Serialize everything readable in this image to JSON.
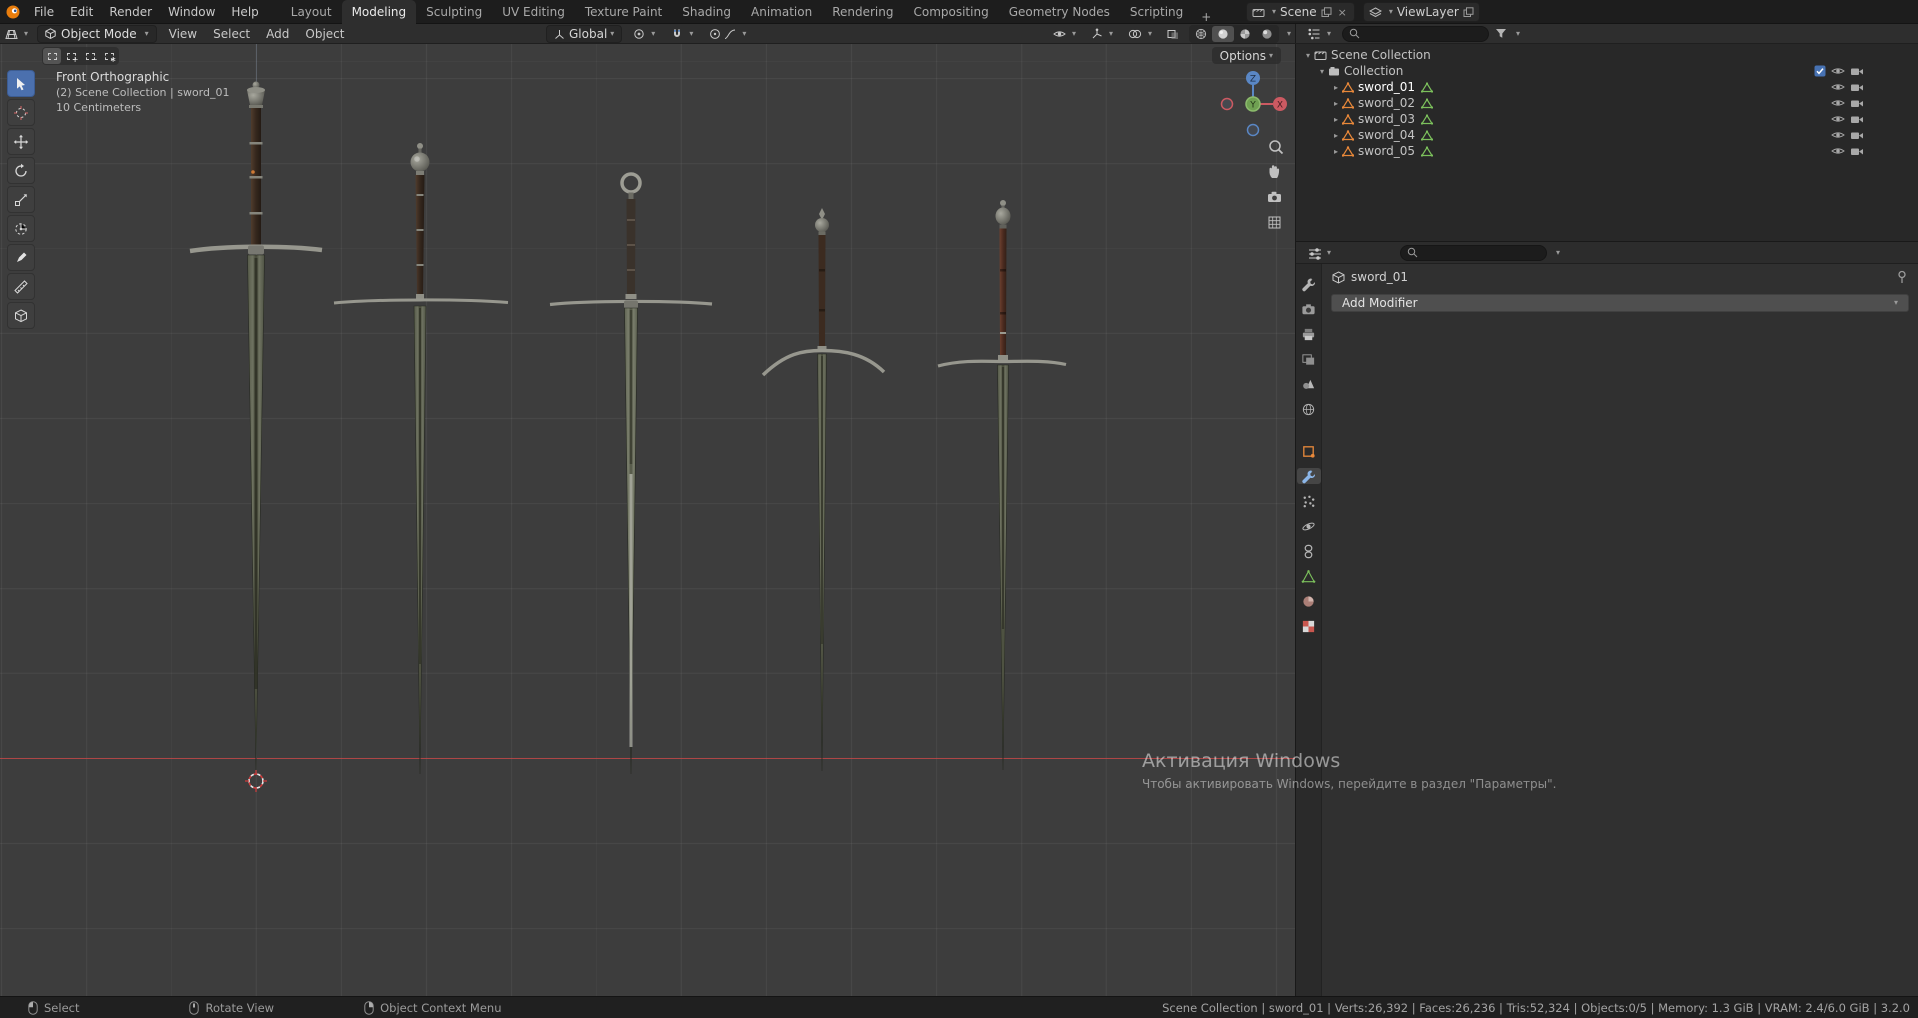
{
  "topbar": {
    "menus": [
      "File",
      "Edit",
      "Render",
      "Window",
      "Help"
    ],
    "workspaces": [
      "Layout",
      "Modeling",
      "Sculpting",
      "UV Editing",
      "Texture Paint",
      "Shading",
      "Animation",
      "Rendering",
      "Compositing",
      "Geometry Nodes",
      "Scripting"
    ],
    "active_workspace": "Modeling",
    "new_workspace_label": "+",
    "scene": {
      "label": "Scene"
    },
    "view_layer": {
      "label": "ViewLayer"
    }
  },
  "viewport_header": {
    "mode": "Object Mode",
    "menus": [
      "View",
      "Select",
      "Add",
      "Object"
    ],
    "orientation": "Global",
    "options_label": "Options"
  },
  "viewport": {
    "overlay": {
      "line1": "Front Orthographic",
      "line2": "(2) Scene Collection | sword_01",
      "line3": "10 Centimeters"
    },
    "gizmo": {
      "z": "Z",
      "y": "Y",
      "x": "X"
    },
    "objects": [
      "sword_01",
      "sword_02",
      "sword_03",
      "sword_04",
      "sword_05"
    ]
  },
  "outliner": {
    "scene_collection": "Scene Collection",
    "collection": "Collection",
    "items": [
      {
        "name": "sword_01"
      },
      {
        "name": "sword_02"
      },
      {
        "name": "sword_03"
      },
      {
        "name": "sword_04"
      },
      {
        "name": "sword_05"
      }
    ]
  },
  "properties": {
    "active_object": "sword_01",
    "add_modifier_label": "Add Modifier"
  },
  "statusbar": {
    "hints": [
      {
        "label": "Select",
        "mouse": "left"
      },
      {
        "label": "Rotate View",
        "mouse": "middle"
      },
      {
        "label": "Object Context Menu",
        "mouse": "right"
      }
    ],
    "info": "Scene Collection | sword_01 | Verts:26,392 | Faces:26,236 | Tris:52,324 | Objects:0/5 | Memory: 1.3 GiB | VRAM: 2.4/6.0 GiB | 3.2.0"
  },
  "watermark": {
    "title": "Активация Windows",
    "subtitle": "Чтобы активировать Windows, перейдите в раздел \"Параметры\"."
  },
  "icons": {
    "caret_down": "▾",
    "expander_open": "▾",
    "expander_closed": "▸"
  },
  "colors": {
    "accent": "#4b70ae",
    "object_orange": "#e8883a",
    "mesh_green": "#7cc05c",
    "axis_x": "#cc5a62",
    "axis_y": "#6fa052",
    "axis_z": "#5a87c5"
  }
}
